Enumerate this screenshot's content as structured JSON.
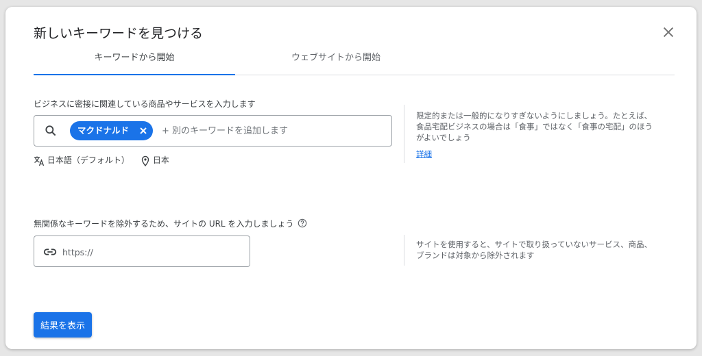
{
  "dialog": {
    "title": "新しいキーワードを見つける",
    "close_icon": "close-icon"
  },
  "tabs": [
    {
      "label": "キーワードから開始",
      "active": true
    },
    {
      "label": "ウェブサイトから開始",
      "active": false
    }
  ],
  "keywords_section": {
    "label": "ビジネスに密接に関連している商品やサービスを入力します",
    "chips": [
      {
        "label": "マクドナルド"
      }
    ],
    "placeholder": "+ 別のキーワードを追加します",
    "language": "日本語（デフォルト）",
    "location": "日本",
    "help_text": "限定的または一般的になりすぎないようにしましょう。たとえば、食品宅配ビジネスの場合は「食事」ではなく「食事の宅配」のほうがよいでしょう",
    "help_link": "詳細"
  },
  "url_section": {
    "label": "無関係なキーワードを除外するため、サイトの URL を入力しましょう",
    "placeholder": "https://",
    "help_text": "サイトを使用すると、サイトで取り扱っていないサービス、商品、ブランドは対象から除外されます"
  },
  "submit_label": "結果を表示",
  "colors": {
    "accent": "#1a73e8",
    "text": "#3c4043",
    "muted": "#5f6368",
    "border": "#dadce0"
  }
}
